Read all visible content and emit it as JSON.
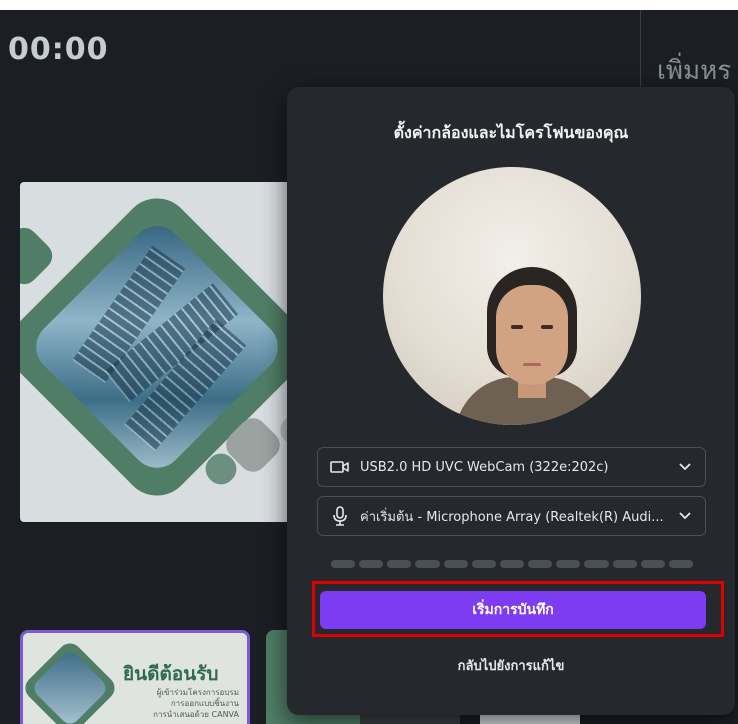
{
  "timer": "00:00",
  "side_panel": {
    "title": "เพิ่มหร"
  },
  "thumbnail": {
    "title": "ยินดีต้อนรับ",
    "subtitle_lines": [
      "ผู้เข้าร่วมโครงการอบรม",
      "การออกแบบชิ้นงาน",
      "การนำเสนอด้วย CANVA"
    ]
  },
  "dialog": {
    "title": "ตั้งค่ากล้องและไมโครโฟนของคุณ",
    "camera_select": {
      "value": "USB2.0 HD UVC WebCam (322e:202c)",
      "icon": "camera-icon"
    },
    "microphone_select": {
      "value": "ค่าเริ่มต้น - Microphone Array (Realtek(R) Audi...",
      "icon": "microphone-icon"
    },
    "level_segments": 13,
    "record_button": "เริ่มการบันทึก",
    "back_link": "กลับไปยังการแก้ไข"
  },
  "colors": {
    "background": "#1b1f24",
    "dialog": "#25282c",
    "accent": "#7d3cf2",
    "highlight": "#e00000"
  }
}
